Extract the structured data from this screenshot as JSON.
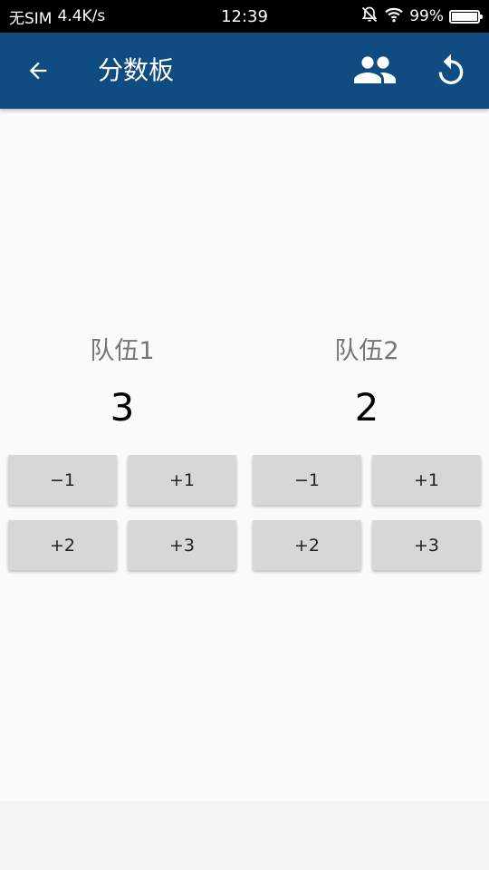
{
  "status_bar": {
    "carrier": "无SIM",
    "speed": "4.4K/s",
    "time": "12:39",
    "battery": "99%"
  },
  "app_bar": {
    "title": "分数板",
    "back_icon": "arrow-left-icon",
    "team_icon": "people-icon",
    "reset_icon": "refresh-icon",
    "background": "#0f4c81"
  },
  "teams": [
    {
      "name": "队伍1",
      "score": "3",
      "buttons": [
        "−1",
        "+1",
        "+2",
        "+3"
      ]
    },
    {
      "name": "队伍2",
      "score": "2",
      "buttons": [
        "−1",
        "+1",
        "+2",
        "+3"
      ]
    }
  ]
}
